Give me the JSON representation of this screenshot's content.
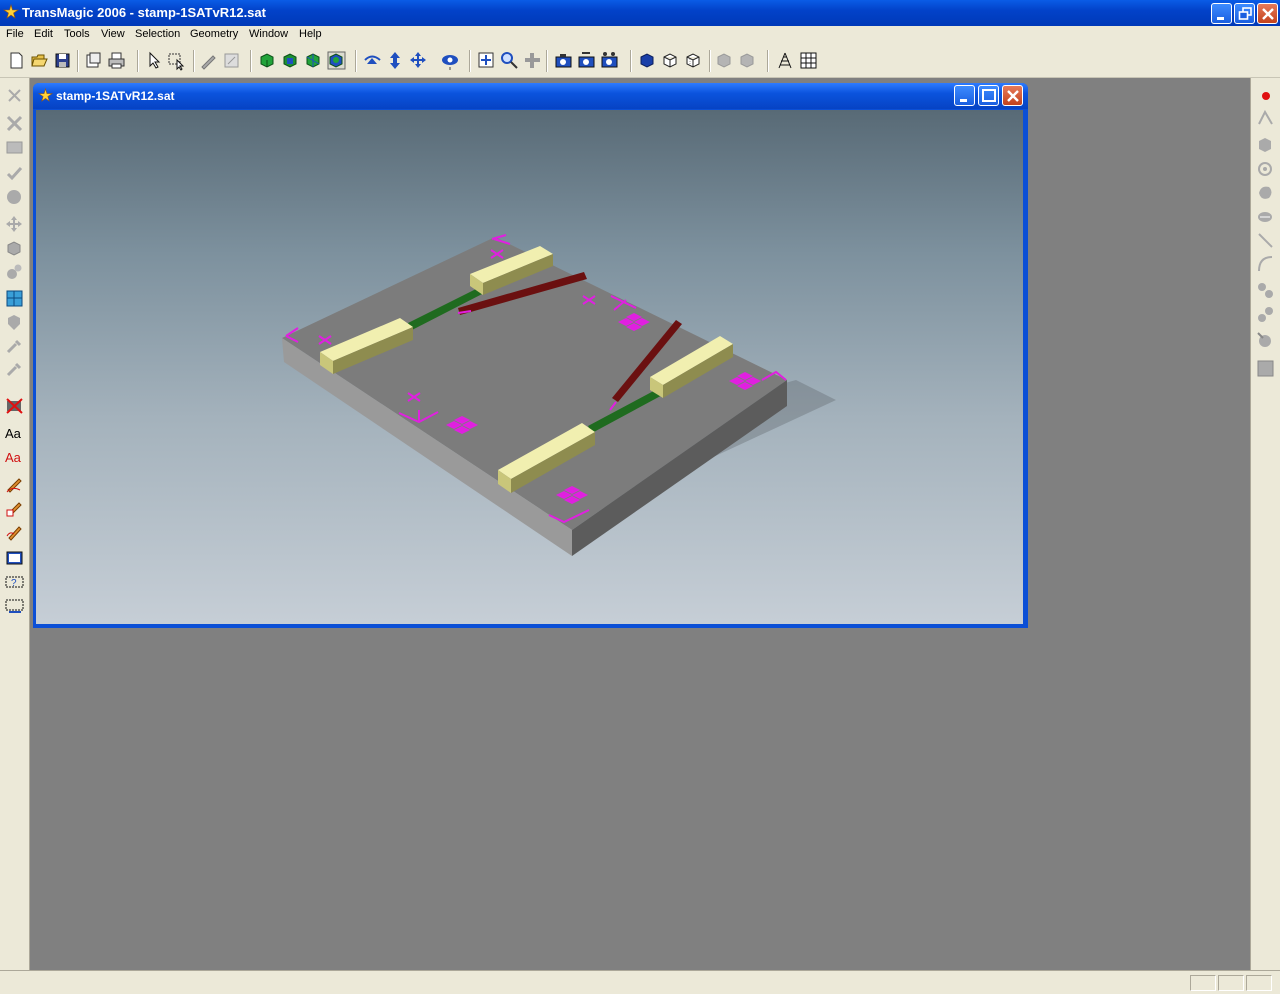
{
  "app": {
    "title": "TransMagic 2006 - stamp-1SATvR12.sat"
  },
  "menubar": {
    "items": [
      "File",
      "Edit",
      "Tools",
      "View",
      "Selection",
      "Geometry",
      "Window",
      "Help"
    ]
  },
  "toolbar": {
    "buttons": [
      "new-icon",
      "open-icon",
      "save-icon",
      "print-preview-icon",
      "print-icon",
      "select-arrow-icon",
      "select-box-icon",
      "pen-icon",
      "eraser-icon",
      "green-solid-icon",
      "green-solid-2-icon",
      "green-solid-3-icon",
      "green-solid-4-icon",
      "rotate-icon",
      "pan-vertical-icon",
      "pan-icon",
      "look-icon",
      "zoom-fit-icon",
      "zoom-window-icon",
      "add-icon",
      "camera-icon",
      "camera-2-icon",
      "camera-3-icon",
      "shaded-icon",
      "wireframe-icon",
      "hidden-line-icon",
      "gray-cube-icon",
      "gray-cube-2-icon",
      "perspective-icon",
      "grid-icon"
    ]
  },
  "document": {
    "title": "stamp-1SATvR12.sat"
  },
  "left_toolbar": {
    "text_tools": [
      "Aa",
      "Aa"
    ]
  },
  "colors": {
    "titlebar": "#0a5ce6",
    "chrome": "#ece9d8",
    "workspace": "#808080",
    "plate_top": "#7a7a7a",
    "plate_front": "#8c8c8c",
    "plate_side": "#5c5c5c",
    "yellow_block": "#e8e6a0",
    "green_bar": "#1f6b1f",
    "red_bar": "#6b1010",
    "magenta_marker": "#e020e0"
  }
}
